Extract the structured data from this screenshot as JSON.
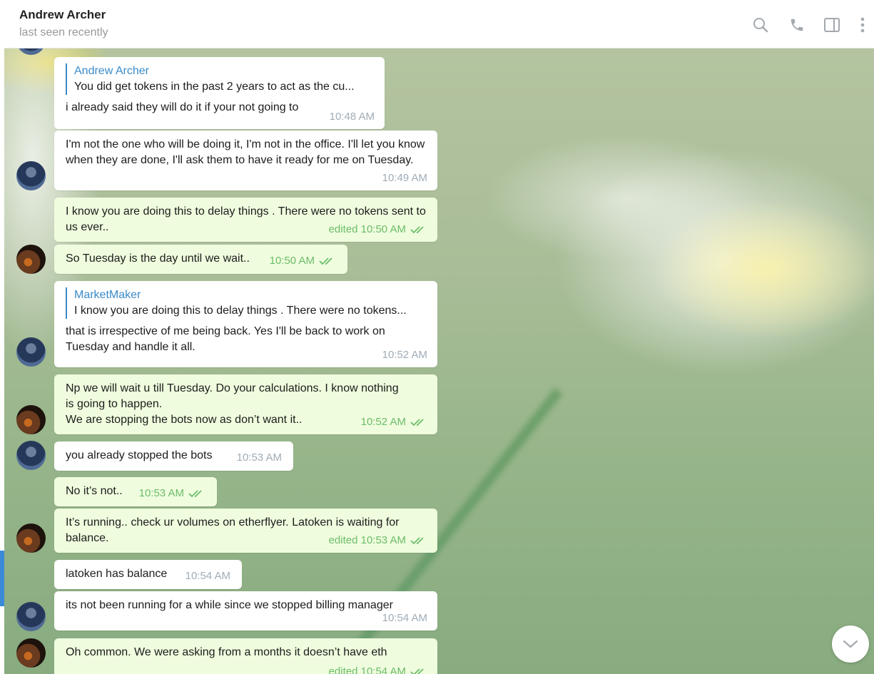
{
  "header": {
    "title": "Andrew Archer",
    "status": "last seen recently",
    "icons": [
      "search-icon",
      "phone-icon",
      "sidebar-toggle-icon",
      "more-menu-icon"
    ]
  },
  "colors": {
    "incoming_bubble": "#ffffff",
    "outgoing_bubble": "#effdde",
    "outgoing_meta": "#6cbc6a",
    "incoming_meta": "#a0acb6",
    "reply_accent": "#3a8bc9"
  },
  "messages": [
    {
      "direction": "in",
      "reply": {
        "name": "Andrew Archer",
        "text": "You did get tokens in the past 2 years to act as the cu..."
      },
      "text": "i already said they will do it if your not going to",
      "time": "10:48 AM"
    },
    {
      "direction": "in",
      "text": "I'm not the one who will be doing it, I'm not in the office. I'll let you know when they are done, I'll ask them to have it ready for me on Tuesday.",
      "time": "10:49 AM"
    },
    {
      "direction": "out",
      "text": "I know you are doing this to delay things . There were no tokens sent to us ever..",
      "time": "edited 10:50 AM"
    },
    {
      "direction": "out",
      "text": "So Tuesday is the day until we wait..",
      "time": "10:50 AM"
    },
    {
      "direction": "in",
      "reply": {
        "name": "MarketMaker",
        "text": "I know you are doing this to delay things . There were no tokens..."
      },
      "text": "that is irrespective of me being back. Yes I'll be back to work on Tuesday and handle it all.",
      "time": "10:52 AM"
    },
    {
      "direction": "out",
      "text": "Np we will wait u till Tuesday. Do your calculations. I know nothing is going to happen.\nWe are stopping the bots now as don’t want it..",
      "time": "10:52 AM"
    },
    {
      "direction": "in",
      "text": "you already stopped the bots",
      "time": "10:53 AM"
    },
    {
      "direction": "out",
      "text": "No it’s not..",
      "time": "10:53 AM"
    },
    {
      "direction": "out",
      "text": "It’s running.. check ur volumes on etherflyer. Latoken is waiting for balance.",
      "time": "edited 10:53 AM"
    },
    {
      "direction": "in",
      "text": "latoken has balance",
      "time": "10:54 AM"
    },
    {
      "direction": "in",
      "text": "its not been running for a while since we stopped billing manager",
      "time": "10:54 AM"
    },
    {
      "direction": "out",
      "text": "Oh common. We were asking from a months it doesn’t have eth",
      "time": "edited 10:54 AM"
    }
  ]
}
